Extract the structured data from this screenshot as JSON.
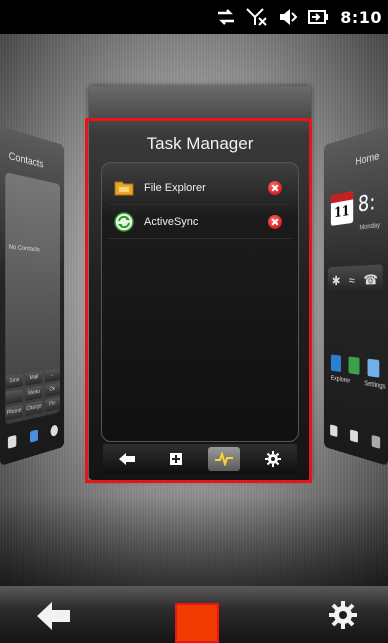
{
  "status_bar": {
    "time": "8:10",
    "icons": [
      "data-sync-icon",
      "no-signal-icon",
      "volume-icon",
      "battery-charging-icon"
    ]
  },
  "left_card": {
    "title": "Contacts",
    "caption": "No Contacts",
    "keys": [
      "Sms",
      "Mail",
      "←",
      "",
      "Menu",
      "Ok",
      "Phone",
      "Charge",
      "Pin"
    ]
  },
  "right_card": {
    "title": "Home",
    "calendar_day": "11",
    "clock": "8:",
    "day_label": "Monday",
    "app_label_1": "Explorer",
    "app_label_2": "Settings"
  },
  "task_manager": {
    "title": "Task Manager",
    "tasks": [
      {
        "name": "File Explorer",
        "icon": "folder-icon"
      },
      {
        "name": "ActiveSync",
        "icon": "activesync-icon"
      }
    ],
    "toolbar": [
      "back-icon",
      "add-window-icon",
      "activity-icon",
      "gear-icon"
    ],
    "active_toolbar_index": 2
  },
  "bottom_bar": {
    "buttons": [
      "back-icon",
      "center-key",
      "gear-icon"
    ],
    "center_color": "#f23b00"
  },
  "colors": {
    "highlight": "#e8141a",
    "close": "#c00000"
  }
}
